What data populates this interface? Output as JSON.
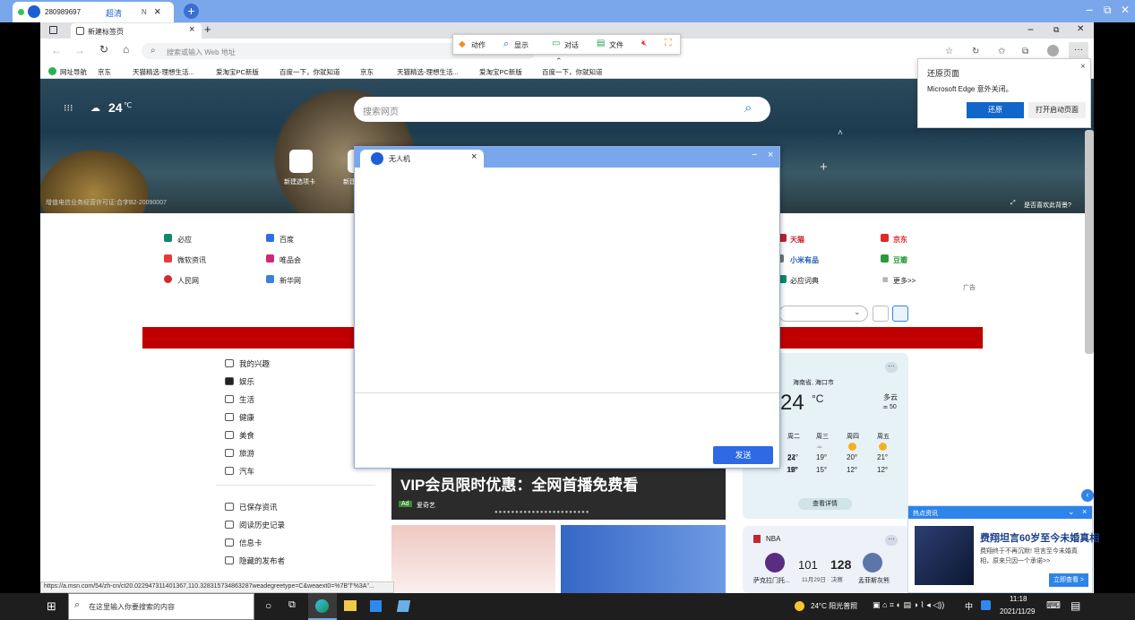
{
  "rd": {
    "id": "280989697",
    "quality": "超清",
    "n": "N",
    "close": "×",
    "add": "+",
    "min": "−",
    "restore": "⧉",
    "closewin": "✕"
  },
  "browser": {
    "tab_title": "新建标签页",
    "tab_close": "×",
    "new_tab": "+",
    "address_placeholder": "搜索或输入 Web 地址",
    "win_min": "−",
    "win_restore": "⧉",
    "win_close": "✕",
    "favorites": [
      "网址导航",
      "京东",
      "天猫精选-理想生活...",
      "爱淘宝PC新版",
      "百度一下，你就知道",
      "京东",
      "天猫精选-理想生活...",
      "爱淘宝PC新版",
      "百度一下，你就知道"
    ]
  },
  "toolbar": {
    "action": "动作",
    "display": "显示",
    "chat": "对话",
    "file": "文件"
  },
  "hero": {
    "temp": "24",
    "unit": "℃",
    "search_placeholder": "搜索网页",
    "new_tab_label": "新建选项卡",
    "new_tab_label2": "新建",
    "license": "增值电信业务经营许可证:合字B2-20090007",
    "like_bg": "是否喜欢此背景?"
  },
  "links": {
    "col1": [
      "必应",
      "微软资讯",
      "人民网"
    ],
    "col2": [
      "百度",
      "唯品会",
      "新华网"
    ],
    "col3": [
      "天猫",
      "小米有品",
      "必应词典"
    ],
    "col4": [
      "京东",
      "豆瓣",
      "更多>>"
    ],
    "ad": "广告"
  },
  "menu": {
    "items": [
      "我的兴趣",
      "娱乐",
      "生活",
      "健康",
      "美食",
      "旅游",
      "汽车"
    ],
    "items2": [
      "已保存资讯",
      "阅读历史记录",
      "信息卡",
      "隐藏的发布者"
    ]
  },
  "weather": {
    "location": "海南省, 海口市",
    "temp": "24",
    "unit": "°C",
    "cond": "多云",
    "aqi": "50",
    "days": [
      "周二",
      "周三",
      "周四",
      "周五"
    ],
    "high": [
      "22°",
      "19°",
      "20°",
      "21°"
    ],
    "low": [
      "18°",
      "15°",
      "12°",
      "12°"
    ],
    "today_high": "24",
    "today_low": "19°",
    "details": "查看详情"
  },
  "vip": {
    "headline": "VIP会员限时优惠：全网首播免费看",
    "ad": "Ad",
    "source": "爱奇艺"
  },
  "nba": {
    "label": "NBA",
    "score1": "101",
    "score2": "128",
    "date": "11月29日 · 决赛",
    "team1": "萨克拉门托...",
    "team2": "孟菲斯灰熊"
  },
  "restore": {
    "title": "还原页面",
    "msg": "Microsoft Edge 意外关闭。",
    "btn_restore": "还原",
    "btn_open": "打开启动页面"
  },
  "hot": {
    "head": "热点资讯",
    "title": "费翔坦言60岁至今未婚真相",
    "body": "费翔终于不再沉默! 坦言至今未婚真相，原来只因一个承诺>>",
    "btn": "立即查看 >"
  },
  "dialog": {
    "title": "无人机",
    "close": "×",
    "min": "−",
    "x": "×",
    "send": "发送"
  },
  "status_url": "https://a.msn.com/54/zh-cn/ct20.022947311401367,110.328315734863287weadegreetype=C&weaext0=%7B\"l\"%3A\"...",
  "taskbar": {
    "search": "在这里输入你要搜索的内容",
    "weather": "24°C 阳光普照",
    "ime": "中",
    "time": "11:18",
    "date": "2021/11/29"
  }
}
